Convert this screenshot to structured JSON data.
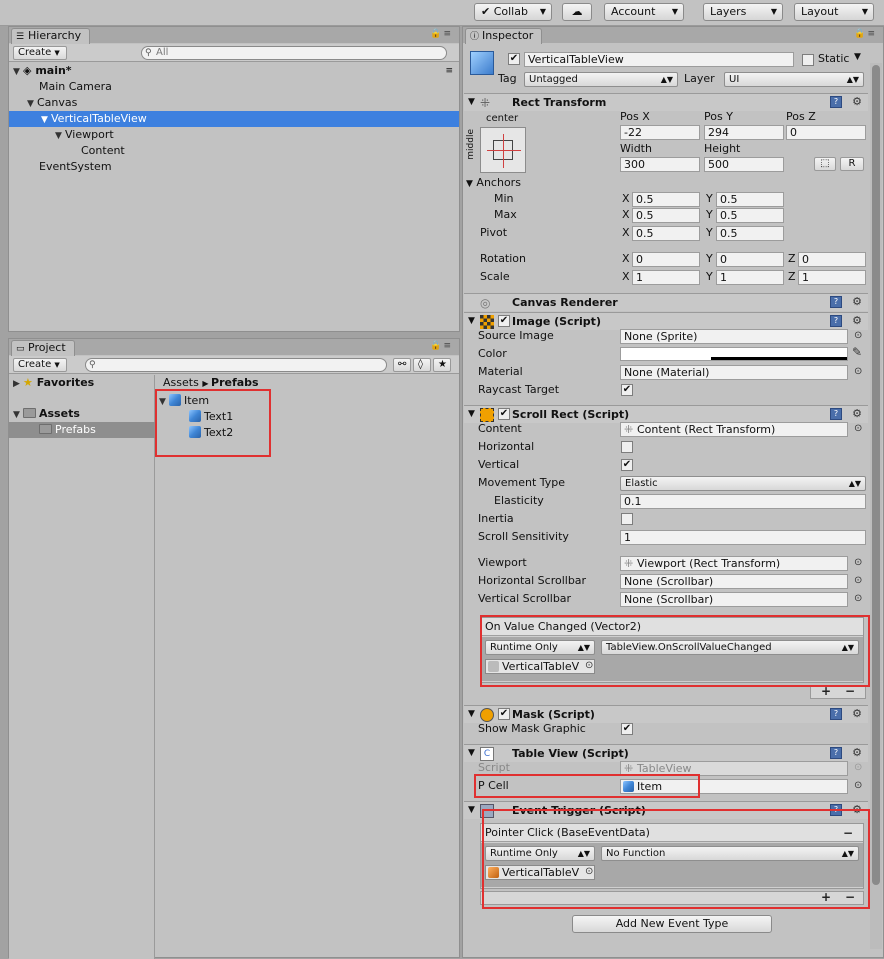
{
  "toolbar": {
    "collab": "Collab",
    "account": "Account",
    "layers": "Layers",
    "layout": "Layout"
  },
  "hierarchy": {
    "tab": "Hierarchy",
    "create": "Create",
    "search_placeholder": "All",
    "scene": "main*",
    "items": [
      "Main Camera",
      "Canvas",
      "VerticalTableView",
      "Viewport",
      "Content",
      "EventSystem"
    ]
  },
  "project": {
    "tab": "Project",
    "create": "Create",
    "favorites": "Favorites",
    "assets": "Assets",
    "prefabs": "Prefabs",
    "breadcrumb_root": "Assets",
    "breadcrumb_leaf": "Prefabs",
    "items": [
      "Item",
      "Text1",
      "Text2"
    ]
  },
  "inspector": {
    "tab": "Inspector",
    "object_name": "VerticalTableView",
    "static": "Static",
    "tag_label": "Tag",
    "tag_value": "Untagged",
    "layer_label": "Layer",
    "layer_value": "UI",
    "rect_transform": {
      "title": "Rect Transform",
      "anchor_h": "center",
      "anchor_v": "middle",
      "posx_label": "Pos X",
      "posy_label": "Pos Y",
      "posz_label": "Pos Z",
      "posx": "-22",
      "posy": "294",
      "posz": "0",
      "width_label": "Width",
      "height_label": "Height",
      "width": "300",
      "height": "500",
      "r_btn": "R",
      "anchors": "Anchors",
      "min": "Min",
      "max": "Max",
      "pivot": "Pivot",
      "min_x": "0.5",
      "min_y": "0.5",
      "max_x": "0.5",
      "max_y": "0.5",
      "pivot_x": "0.5",
      "pivot_y": "0.5",
      "rotation": "Rotation",
      "scale": "Scale",
      "rot_x": "0",
      "rot_y": "0",
      "rot_z": "0",
      "scale_x": "1",
      "scale_y": "1",
      "scale_z": "1",
      "x": "X",
      "y": "Y",
      "z": "Z"
    },
    "canvas_renderer": "Canvas Renderer",
    "image": {
      "title": "Image (Script)",
      "source_image": "Source Image",
      "source_image_value": "None (Sprite)",
      "color": "Color",
      "material": "Material",
      "material_value": "None (Material)",
      "raycast": "Raycast Target"
    },
    "scroll_rect": {
      "title": "Scroll Rect (Script)",
      "content": "Content",
      "content_value": "Content (Rect Transform)",
      "horizontal": "Horizontal",
      "vertical": "Vertical",
      "movement_type": "Movement Type",
      "movement_value": "Elastic",
      "elasticity": "Elasticity",
      "elasticity_value": "0.1",
      "inertia": "Inertia",
      "scroll_sensitivity": "Scroll Sensitivity",
      "scroll_sensitivity_value": "1",
      "viewport": "Viewport",
      "viewport_value": "Viewport (Rect Transform)",
      "hscroll": "Horizontal Scrollbar",
      "hscroll_value": "None (Scrollbar)",
      "vscroll": "Vertical Scrollbar",
      "vscroll_value": "None (Scrollbar)",
      "event_title": "On Value Changed (Vector2)",
      "runtime": "Runtime Only",
      "function": "TableView.OnScrollValueChanged",
      "target": "VerticalTableV"
    },
    "mask": {
      "title": "Mask (Script)",
      "show_graphic": "Show Mask Graphic"
    },
    "table_view": {
      "title": "Table View (Script)",
      "script": "Script",
      "script_value": "TableView",
      "pcell": "P Cell",
      "pcell_value": "Item"
    },
    "event_trigger": {
      "title": "Event Trigger (Script)",
      "event_title": "Pointer Click (BaseEventData)",
      "runtime": "Runtime Only",
      "function": "No Function",
      "target": "VerticalTableV",
      "add_button": "Add New Event Type"
    }
  },
  "colors": {
    "selection": "#3d80df",
    "highlight_box": "#e03030"
  }
}
